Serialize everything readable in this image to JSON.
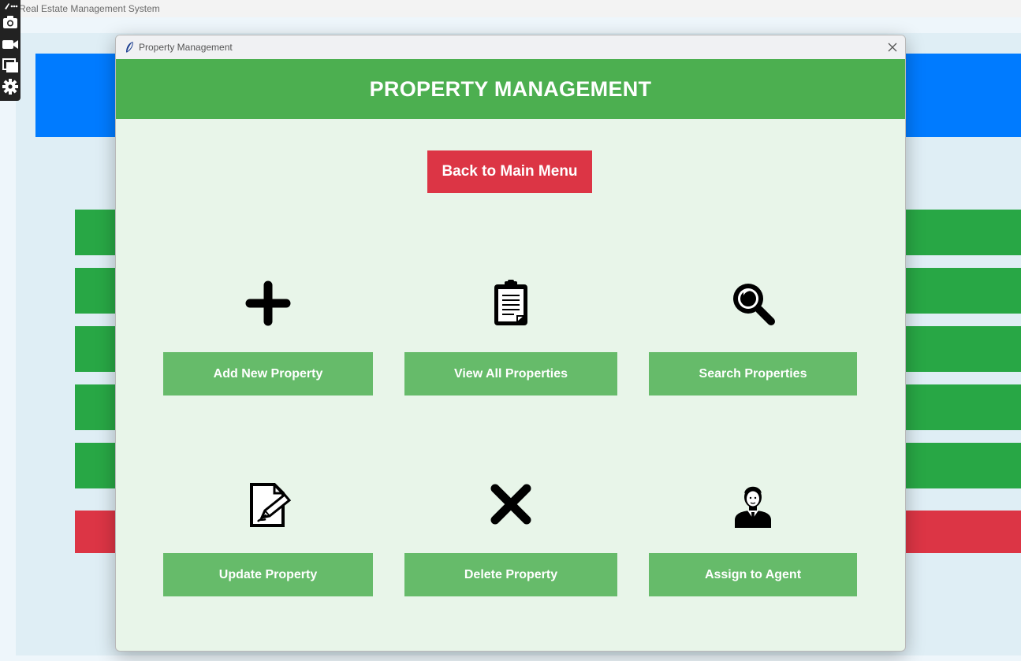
{
  "main_window": {
    "title": "Real Estate Management System",
    "header_color": "#007bff",
    "button_color": "#28a745",
    "exit_color": "#dc3545"
  },
  "toolbar": {
    "icons": [
      "more-icon",
      "camera-icon",
      "video-icon",
      "window-icon",
      "gear-icon"
    ]
  },
  "dialog": {
    "title": "Property Management",
    "banner": "PROPERTY MANAGEMENT",
    "back_button": "Back to Main Menu",
    "colors": {
      "banner": "#4caf50",
      "body": "#e8f5e9",
      "action_button": "#66bb6a",
      "back_button": "#dc3545"
    },
    "actions": [
      {
        "label": "Add New Property",
        "icon": "plus-icon"
      },
      {
        "label": "View All Properties",
        "icon": "clipboard-icon"
      },
      {
        "label": "Search Properties",
        "icon": "magnifier-icon"
      },
      {
        "label": "Update Property",
        "icon": "edit-document-icon"
      },
      {
        "label": "Delete Property",
        "icon": "cross-icon"
      },
      {
        "label": "Assign to Agent",
        "icon": "agent-icon"
      }
    ]
  }
}
